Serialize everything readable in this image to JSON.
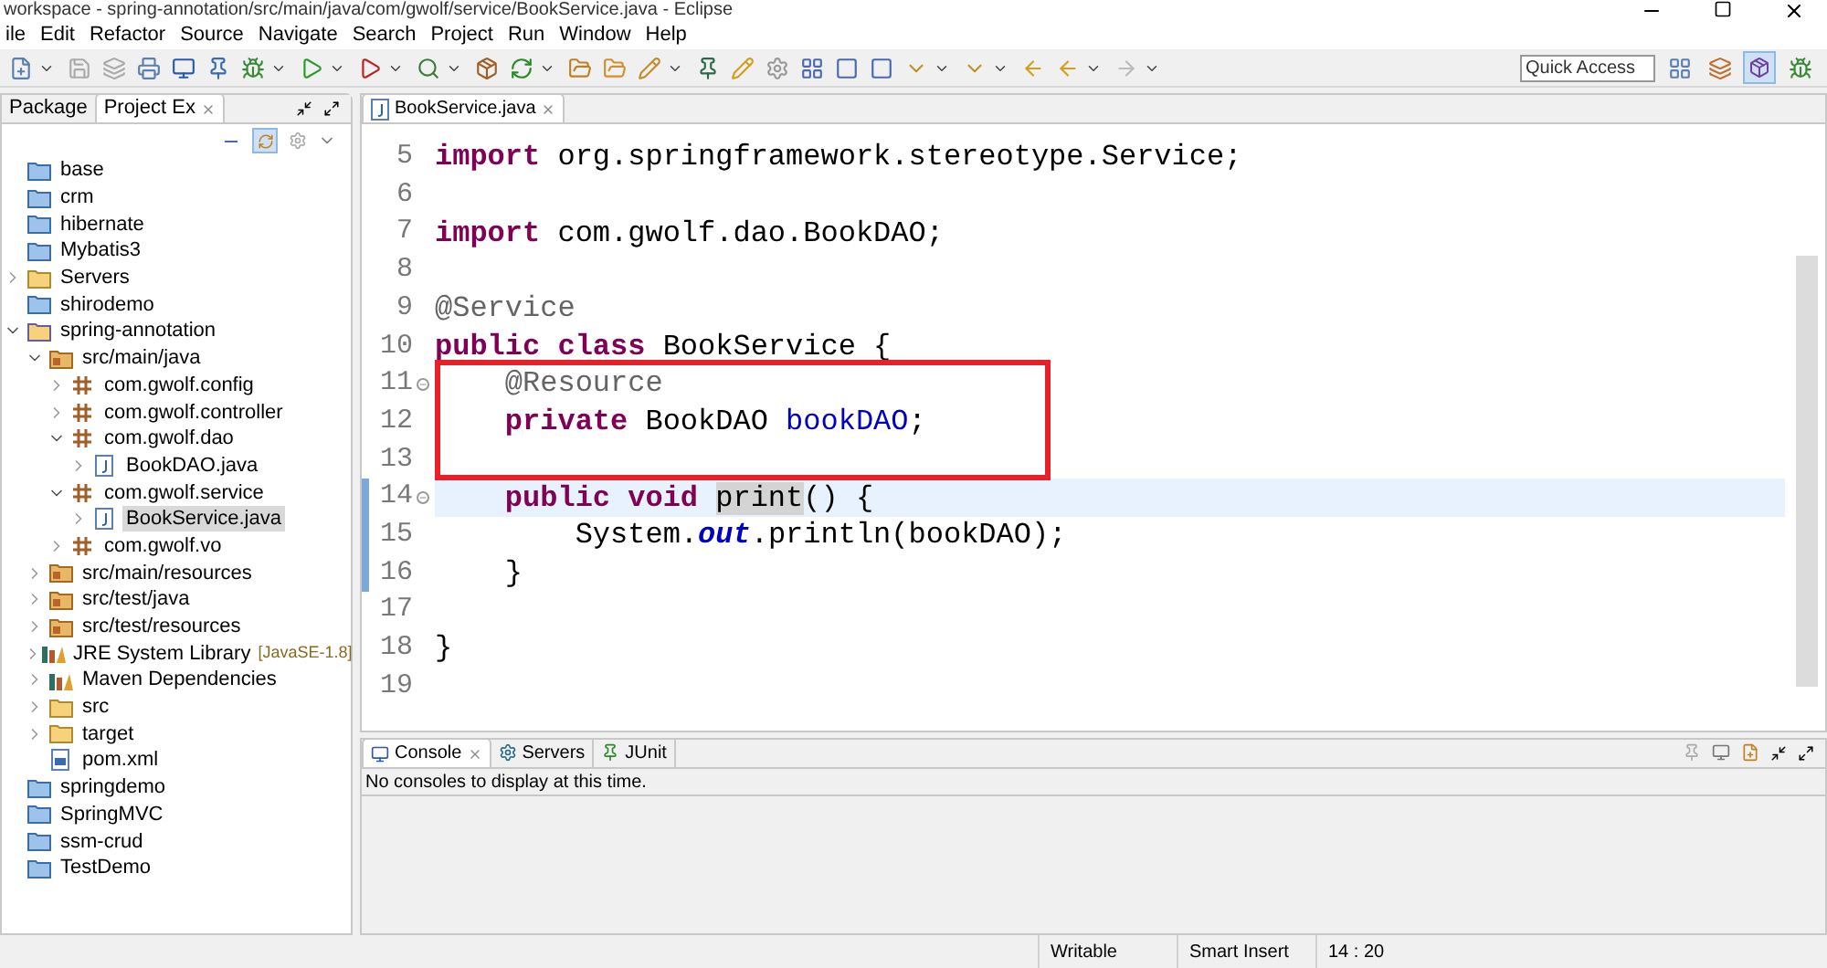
{
  "window": {
    "title": "workspace - spring-annotation/src/main/java/com/gwolf/service/BookService.java - Eclipse"
  },
  "menu": [
    "ile",
    "Edit",
    "Refactor",
    "Source",
    "Navigate",
    "Search",
    "Project",
    "Run",
    "Window",
    "Help"
  ],
  "quick_access": {
    "placeholder": "Quick Access"
  },
  "left_tabs": [
    {
      "label": "Package",
      "selected": false
    },
    {
      "label": "Project Ex",
      "selected": true
    }
  ],
  "tree": [
    {
      "label": "base",
      "kind": "project"
    },
    {
      "label": "crm",
      "kind": "project"
    },
    {
      "label": "hibernate",
      "kind": "project"
    },
    {
      "label": "Mybatis3",
      "kind": "project"
    },
    {
      "label": "Servers",
      "kind": "folder",
      "expanded": false
    },
    {
      "label": "shirodemo",
      "kind": "project"
    },
    {
      "label": "spring-annotation",
      "kind": "maven",
      "expanded": true,
      "children": [
        {
          "label": "src/main/java",
          "kind": "srcfolder",
          "expanded": true,
          "children": [
            {
              "label": "com.gwolf.config",
              "kind": "package",
              "expanded": false
            },
            {
              "label": "com.gwolf.controller",
              "kind": "package",
              "expanded": false
            },
            {
              "label": "com.gwolf.dao",
              "kind": "package",
              "expanded": true,
              "children": [
                {
                  "label": "BookDAO.java",
                  "kind": "java",
                  "expanded": false,
                  "selected": false
                }
              ]
            },
            {
              "label": "com.gwolf.service",
              "kind": "package",
              "expanded": true,
              "children": [
                {
                  "label": "BookService.java",
                  "kind": "java",
                  "expanded": false,
                  "selected": true
                }
              ]
            },
            {
              "label": "com.gwolf.vo",
              "kind": "package",
              "expanded": false
            }
          ]
        },
        {
          "label": "src/main/resources",
          "kind": "srcfolder",
          "expanded": false
        },
        {
          "label": "src/test/java",
          "kind": "srcfolder",
          "expanded": false
        },
        {
          "label": "src/test/resources",
          "kind": "srcfolder",
          "expanded": false
        },
        {
          "label": "JRE System Library",
          "suffix": "[JavaSE-1.8]",
          "kind": "library",
          "expanded": false
        },
        {
          "label": "Maven Dependencies",
          "kind": "library",
          "expanded": false
        },
        {
          "label": "src",
          "kind": "folder",
          "expanded": false
        },
        {
          "label": "target",
          "kind": "folder",
          "expanded": false
        },
        {
          "label": "pom.xml",
          "kind": "xml"
        }
      ]
    },
    {
      "label": "springdemo",
      "kind": "project"
    },
    {
      "label": "SpringMVC",
      "kind": "project"
    },
    {
      "label": "ssm-crud",
      "kind": "project"
    },
    {
      "label": "TestDemo",
      "kind": "project"
    }
  ],
  "editor": {
    "tab": "BookService.java",
    "lines": [
      {
        "num": "5",
        "tokens": [
          {
            "kind": "keyword",
            "text": "import"
          },
          {
            "kind": "plain",
            "text": " org.springframework.stereotype.Service;"
          }
        ]
      },
      {
        "num": "6"
      },
      {
        "num": "7",
        "tokens": [
          {
            "kind": "keyword",
            "text": "import"
          },
          {
            "kind": "plain",
            "text": " com.gwolf.dao.BookDAO;"
          }
        ]
      },
      {
        "num": "8"
      },
      {
        "num": "9",
        "tokens": [
          {
            "kind": "annotation",
            "text": "@Service"
          }
        ]
      },
      {
        "num": "10",
        "tokens": [
          {
            "kind": "keyword",
            "text": "public"
          },
          {
            "kind": "keyword",
            "text": " class"
          },
          {
            "kind": "plain",
            "text": " BookService {"
          }
        ]
      },
      {
        "num": "11",
        "fold": true,
        "tokens": [
          {
            "kind": "annotation",
            "text": "    @Resource"
          }
        ]
      },
      {
        "num": "12",
        "tokens": [
          {
            "kind": "keyword",
            "text": "    private"
          },
          {
            "kind": "plain",
            "text": " BookDAO "
          },
          {
            "kind": "field",
            "text": "bookDAO"
          },
          {
            "kind": "plain",
            "text": ";"
          }
        ]
      },
      {
        "num": "13"
      },
      {
        "num": "14",
        "fold": true,
        "current": true,
        "changed": true,
        "tokens": [
          {
            "kind": "keyword",
            "text": "    public"
          },
          {
            "kind": "keyword",
            "text": " void "
          },
          {
            "kind": "occurrence",
            "text": "print"
          },
          {
            "kind": "plain",
            "text": "() {"
          }
        ]
      },
      {
        "num": "15",
        "changed": true,
        "tokens": [
          {
            "kind": "plain",
            "text": "        System."
          },
          {
            "kind": "static",
            "text": "out"
          },
          {
            "kind": "plain",
            "text": ".println(bookDAO);"
          }
        ]
      },
      {
        "num": "16",
        "changed": true,
        "tokens": [
          {
            "kind": "plain",
            "text": "    }"
          }
        ]
      },
      {
        "num": "17"
      },
      {
        "num": "18",
        "tokens": [
          {
            "kind": "plain",
            "text": "}"
          }
        ]
      },
      {
        "num": "19"
      }
    ]
  },
  "bottom_tabs": [
    {
      "label": "Console",
      "selected": true,
      "kind": "console"
    },
    {
      "label": "Servers",
      "selected": false,
      "kind": "servers"
    },
    {
      "label": "JUnit",
      "selected": false,
      "kind": "junit"
    }
  ],
  "console": {
    "message": "No consoles to display at this time."
  },
  "status_bar": [
    "Writable",
    "Smart Insert",
    "14 : 20"
  ]
}
